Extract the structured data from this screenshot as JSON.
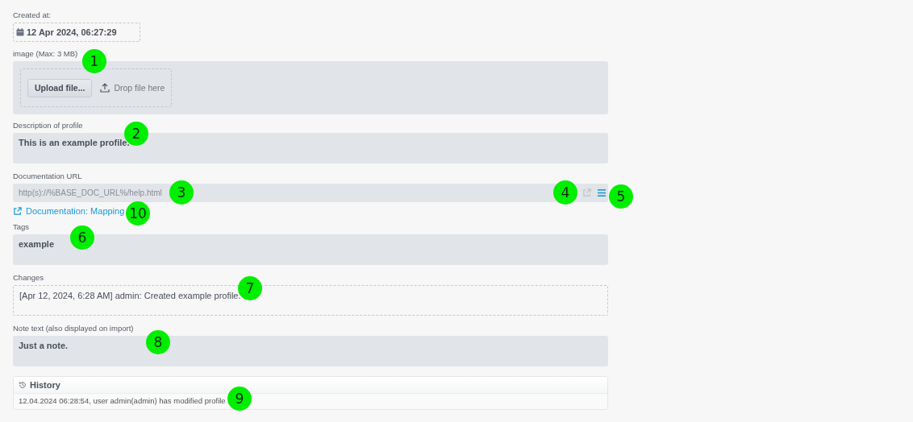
{
  "created_at": {
    "label": "Created at:",
    "value": "12 Apr 2024, 06:27:29"
  },
  "image": {
    "label": "image (Max: 3 MB)",
    "upload_button": "Upload file...",
    "drop_hint": "Drop file here"
  },
  "description": {
    "label": "Description of profile",
    "value": "This is an example profile."
  },
  "documentation_url": {
    "label": "Documentation URL",
    "placeholder": "http(s)://%BASE_DOC_URL%/help.html",
    "open_disabled": true
  },
  "documentation_link": "Documentation: Mapping",
  "tags": {
    "label": "Tags",
    "value": "example"
  },
  "changes": {
    "label": "Changes",
    "value": "[Apr 12, 2024, 6:28 AM] admin: Created example profile."
  },
  "note": {
    "label": "Note text (also displayed on import)",
    "value": "Just a note."
  },
  "history": {
    "title": "History",
    "entries": [
      "12.04.2024 06:28:54, user admin(admin) has modified profile"
    ]
  },
  "callouts": [
    "1",
    "2",
    "3",
    "4",
    "5",
    "6",
    "7",
    "8",
    "9",
    "10"
  ]
}
